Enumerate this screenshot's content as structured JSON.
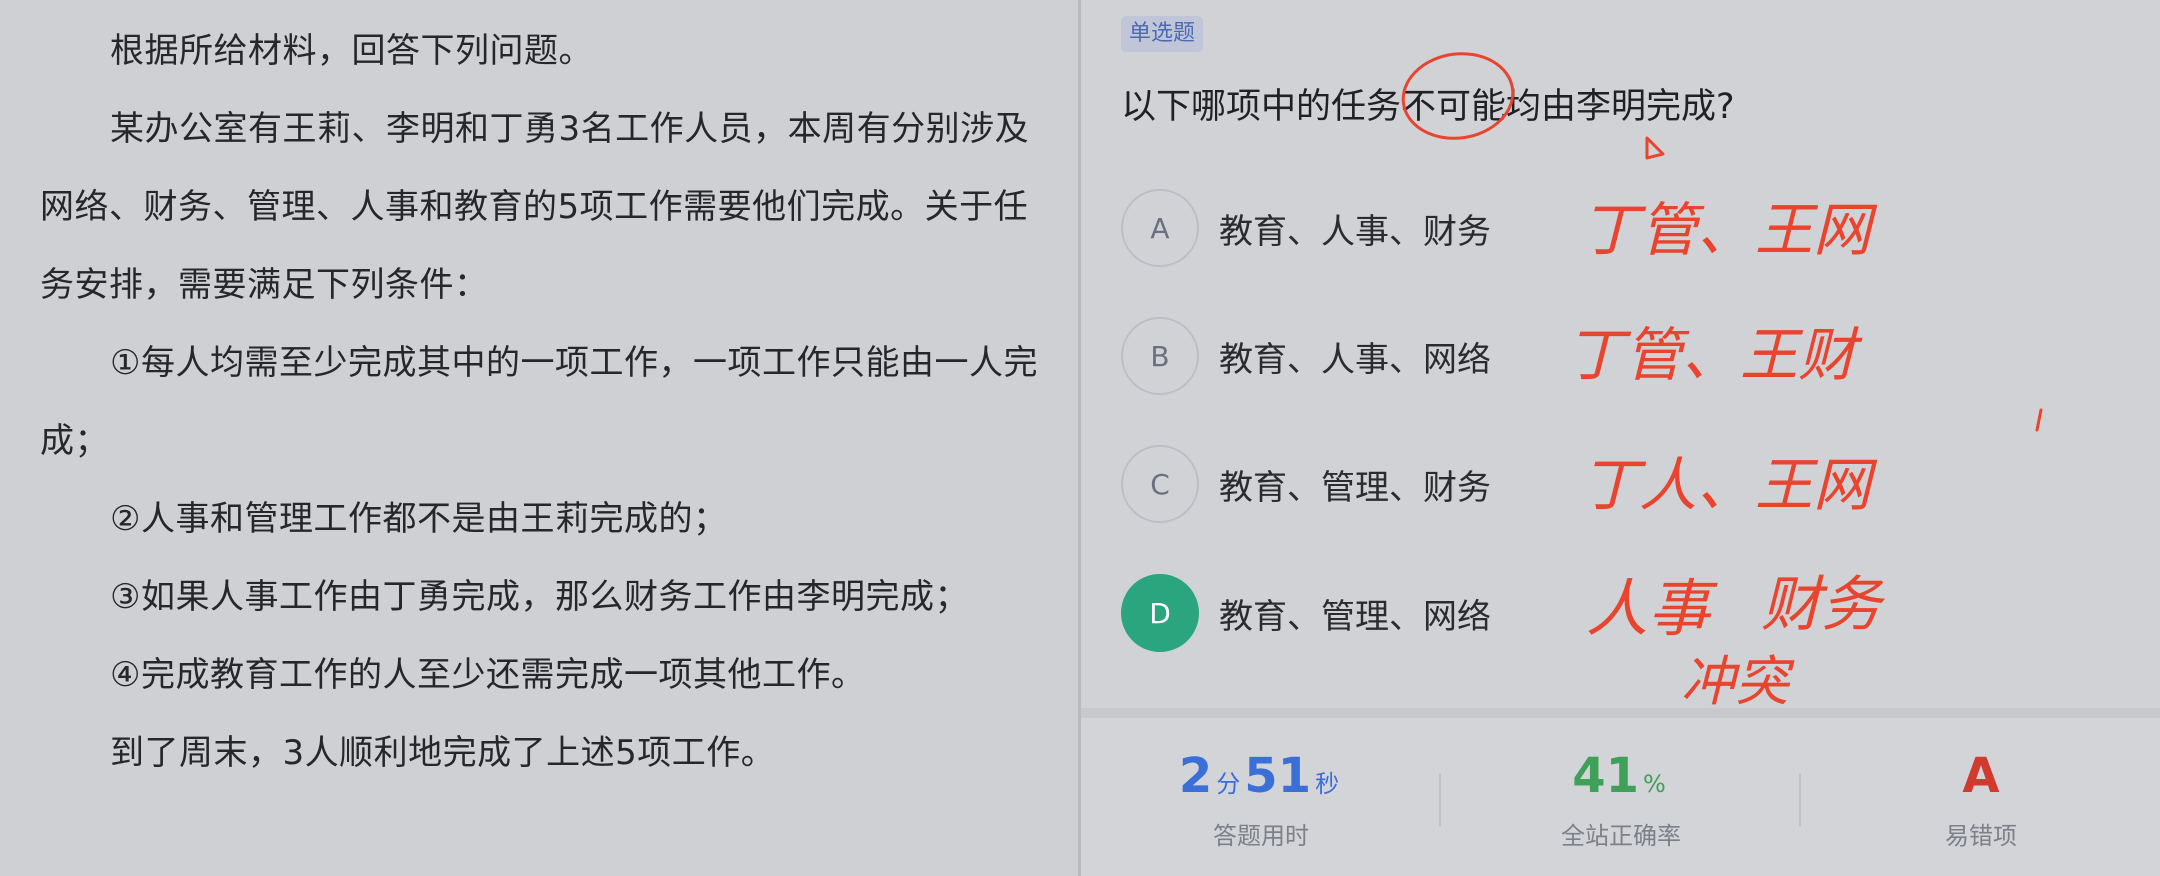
{
  "material": {
    "paragraphs": [
      "根据所给材料，回答下列问题。",
      "某办公室有王莉、李明和丁勇3名工作人员，本周有分别涉及网络、财务、管理、人事和教育的5项工作需要他们完成。关于任务安排，需要满足下列条件：",
      "①每人均需至少完成其中的一项工作，一项工作只能由一人完成；",
      "②人事和管理工作都不是由王莉完成的；",
      "③如果人事工作由丁勇完成，那么财务工作由李明完成；",
      "④完成教育工作的人至少还需完成一项其他工作。",
      "到了周末，3人顺利地完成了上述5项工作。"
    ]
  },
  "question": {
    "type_label": "单选题",
    "stem": "以下哪项中的任务不可能均由李明完成?",
    "options": [
      {
        "letter": "A",
        "text": "教育、人事、财务",
        "selected": false
      },
      {
        "letter": "B",
        "text": "教育、人事、网络",
        "selected": false
      },
      {
        "letter": "C",
        "text": "教育、管理、财务",
        "selected": false
      },
      {
        "letter": "D",
        "text": "教育、管理、网络",
        "selected": true
      }
    ],
    "handwritten_notes": [
      "丁管、王网",
      "丁管、王财",
      "丁人、王网",
      "人事",
      "财务",
      "冲突"
    ]
  },
  "stats": {
    "time": {
      "minutes": "2",
      "min_unit": "分",
      "seconds": "51",
      "sec_unit": "秒",
      "label": "答题用时"
    },
    "accuracy": {
      "value": "41",
      "unit": "%",
      "label": "全站正确率"
    },
    "common_wrong": {
      "value": "A",
      "label": "易错项"
    }
  },
  "colors": {
    "accent_blue": "#3a6fd8",
    "accent_green": "#3fa05a",
    "accent_red": "#d23a2e",
    "selected_option": "#2aa57e",
    "ink": "#e8442e"
  }
}
